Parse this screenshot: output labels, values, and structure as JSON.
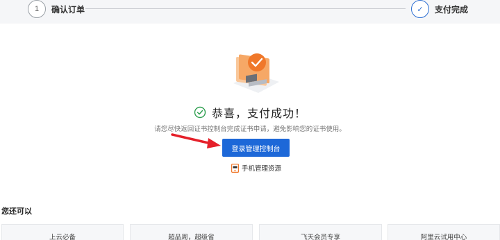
{
  "stepper": {
    "steps": [
      {
        "number": "1",
        "label": "确认订单"
      },
      {
        "number": "✓",
        "label": "支付完成"
      }
    ]
  },
  "success": {
    "title": "恭喜，支付成功！",
    "subtext": "请您尽快返回证书控制台完成证书申请，避免影响您的证书使用。"
  },
  "actions": {
    "console_button": "登录管理控制台",
    "mobile_link": "手机管理资源"
  },
  "also": {
    "title": "您还可以",
    "cards": [
      "上云必备",
      "超品周，超级省",
      "飞天会员专享",
      "阿里云试用中心"
    ]
  },
  "colors": {
    "primary": "#1d68d8",
    "success_green": "#2e9e4f",
    "arrow_red": "#e5202a",
    "accent_orange": "#f0782a"
  }
}
